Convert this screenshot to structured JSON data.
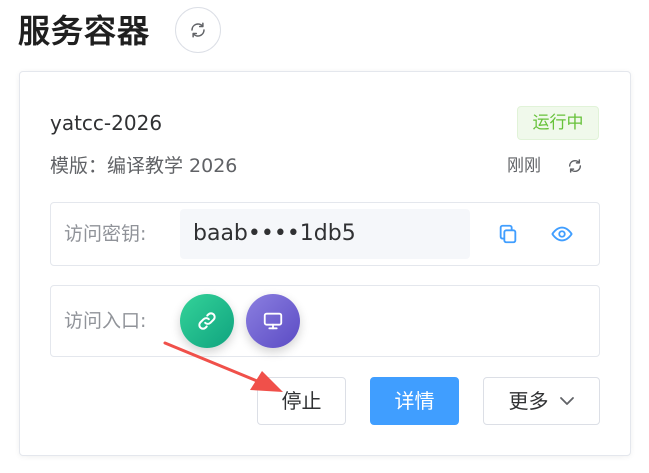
{
  "page": {
    "title": "服务容器"
  },
  "container": {
    "name": "yatcc-2026",
    "status": "运行中",
    "template_text": "模版：编译教学 2026",
    "updated": "刚刚",
    "access_key": {
      "label": "访问密钥:",
      "value": "baab••••1db5"
    },
    "access_entry": {
      "label": "访问入口:"
    }
  },
  "actions": {
    "stop": "停止",
    "detail": "详情",
    "more": "更多"
  },
  "icons": {
    "page_refresh": "refresh-icon",
    "card_refresh": "refresh-icon",
    "copy": "copy-icon",
    "reveal": "eye-icon",
    "link": "link-icon",
    "monitor": "monitor-icon",
    "more_caret": "chevron-down-icon",
    "annotation": "red-arrow"
  },
  "colors": {
    "status_text": "#67c23a",
    "status_bg": "#f0f9eb",
    "primary": "#409eff",
    "link_button": "#10a37f",
    "monitor_button": "#5b4bc4",
    "annotation_arrow": "#f0504a"
  }
}
